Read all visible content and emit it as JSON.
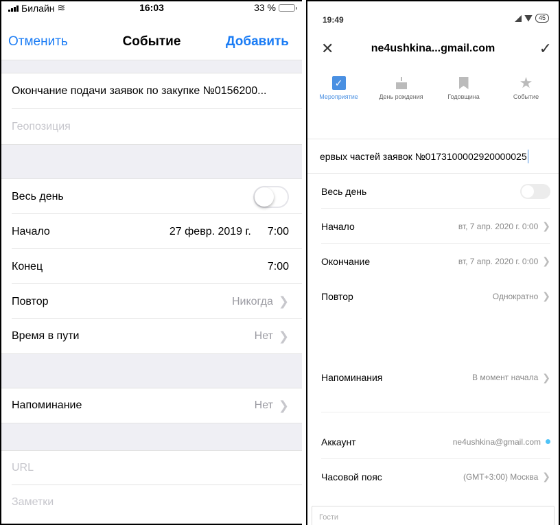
{
  "ios": {
    "status": {
      "carrier": "Билайн",
      "time": "16:03",
      "battery": "33 %",
      "battery_level": 0.33,
      "battery_color": "#f5d000"
    },
    "nav": {
      "cancel": "Отменить",
      "title": "Событие",
      "add": "Добавить",
      "accent_color": "#1a7cf5"
    },
    "title_value": "Окончание подачи заявок по закупке №0156200...",
    "location_placeholder": "Геопозиция",
    "all_day": {
      "label": "Весь день",
      "on": false
    },
    "start": {
      "label": "Начало",
      "date": "27 февр. 2019 г.",
      "time": "7:00"
    },
    "end": {
      "label": "Конец",
      "time": "7:00"
    },
    "repeat": {
      "label": "Повтор",
      "value": "Никогда"
    },
    "travel": {
      "label": "Время в пути",
      "value": "Нет"
    },
    "alert": {
      "label": "Напоминание",
      "value": "Нет"
    },
    "url_placeholder": "URL",
    "notes_placeholder": "Заметки"
  },
  "android": {
    "status": {
      "time": "19:49",
      "battery": "45"
    },
    "nav": {
      "title": "ne4ushkina...gmail.com",
      "close_icon": "close-icon",
      "check_icon": "check-icon"
    },
    "types": [
      {
        "label": "Мероприятие",
        "icon": "checkbox-icon",
        "active": true
      },
      {
        "label": "День рождения",
        "icon": "cake-icon",
        "active": false
      },
      {
        "label": "Годовщина",
        "icon": "bookmark-icon",
        "active": false
      },
      {
        "label": "Событие",
        "icon": "star-icon",
        "active": false
      }
    ],
    "title_value": "ервых частей заявок №0173100002920000025",
    "all_day": {
      "label": "Весь день",
      "on": false
    },
    "start": {
      "label": "Начало",
      "value": "вт, 7 апр. 2020 г. 0:00"
    },
    "end": {
      "label": "Окончание",
      "value": "вт, 7 апр. 2020 г. 0:00"
    },
    "repeat": {
      "label": "Повтор",
      "value": "Однократно"
    },
    "reminders": {
      "label": "Напоминания",
      "value": "В момент начала"
    },
    "account": {
      "label": "Аккаунт",
      "value": "ne4ushkina@gmail.com",
      "dot_color": "#4fc3f7"
    },
    "timezone": {
      "label": "Часовой пояс",
      "value": "(GMT+3:00) Москва"
    },
    "guests_placeholder": "Гости"
  }
}
